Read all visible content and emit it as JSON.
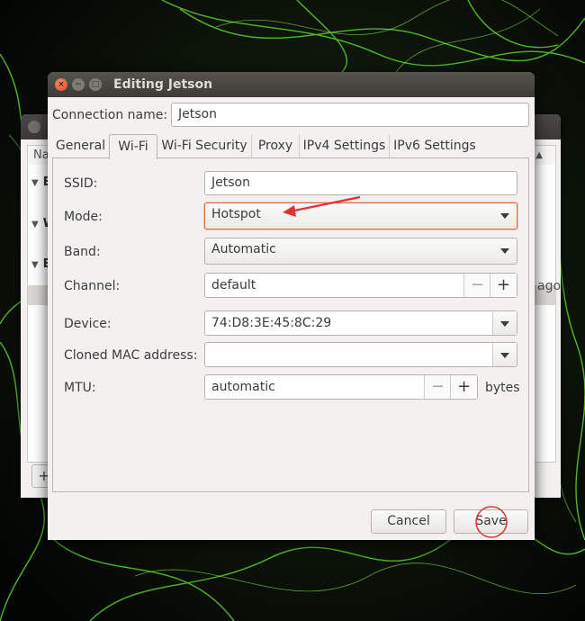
{
  "window": {
    "title": "Editing Jetson"
  },
  "connection": {
    "label": "Connection name:",
    "value": "Jetson"
  },
  "tabs": [
    {
      "label": "General"
    },
    {
      "label": "Wi-Fi",
      "active": true
    },
    {
      "label": "Wi-Fi Security"
    },
    {
      "label": "Proxy"
    },
    {
      "label": "IPv4 Settings"
    },
    {
      "label": "IPv6 Settings"
    }
  ],
  "wifi": {
    "ssid_label": "SSID:",
    "ssid_value": "Jetson",
    "mode_label": "Mode:",
    "mode_value": "Hotspot",
    "band_label": "Band:",
    "band_value": "Automatic",
    "channel_label": "Channel:",
    "channel_value": "default",
    "device_label": "Device:",
    "device_value": "74:D8:3E:45:8C:29",
    "cloned_mac_label": "Cloned MAC address:",
    "cloned_mac_value": "",
    "mtu_label": "MTU:",
    "mtu_value": "automatic",
    "mtu_unit": "bytes"
  },
  "spin": {
    "minus": "−",
    "plus": "+"
  },
  "buttons": {
    "cancel": "Cancel",
    "save": "Save"
  },
  "background_window": {
    "header_text": "Na",
    "row_initials": [
      "E",
      "W",
      "E"
    ],
    "trailing_text": "ago",
    "add_button": "+"
  },
  "colors": {
    "highlight": "#e26a3e",
    "annotation": "#e03030"
  },
  "icons": {
    "close": "close-icon",
    "minimize": "minimize-icon",
    "maximize": "maximize-icon",
    "dropdown": "chevron-down-icon"
  }
}
